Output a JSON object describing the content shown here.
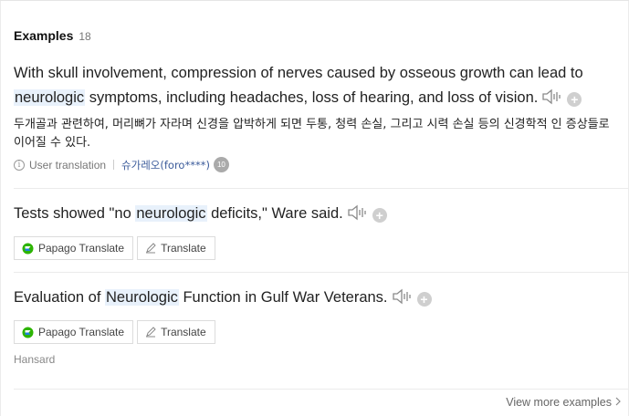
{
  "section": {
    "title": "Examples",
    "count": "18"
  },
  "examples": [
    {
      "before": "With skull involvement, compression of nerves caused by osseous growth can lead to ",
      "highlight": "neurologic",
      "after": " symptoms, including headaches, loss of hearing, and loss of vision.",
      "translation": "두개골과 관련하여, 머리뼈가 자라며 신경을 압박하게 되면 두통, 청력 손실, 그리고 시력 손실 등의 신경학적 인 증상들로 이어질 수 있다.",
      "translation_label": "User translation",
      "user": "슈가레오(foro****)",
      "badge": "10"
    },
    {
      "before": "Tests showed \"no ",
      "highlight": "neurologic",
      "after": " deficits,\" Ware said.",
      "papago_label": "Papago Translate",
      "translate_label": "Translate"
    },
    {
      "before": "Evaluation of ",
      "highlight": "Neurologic",
      "after": " Function in Gulf War Veterans.",
      "papago_label": "Papago Translate",
      "translate_label": "Translate",
      "source": "Hansard"
    }
  ],
  "view_more": "View more examples",
  "icons": {
    "speaker": "speaker-icon",
    "add": "plus-icon",
    "info": "info-icon",
    "papago": "papago-logo-icon",
    "pencil": "pencil-icon",
    "chevron": "chevron-right-icon"
  },
  "colors": {
    "highlight": "#e8f1fb",
    "user_link": "#3a5a9a"
  }
}
